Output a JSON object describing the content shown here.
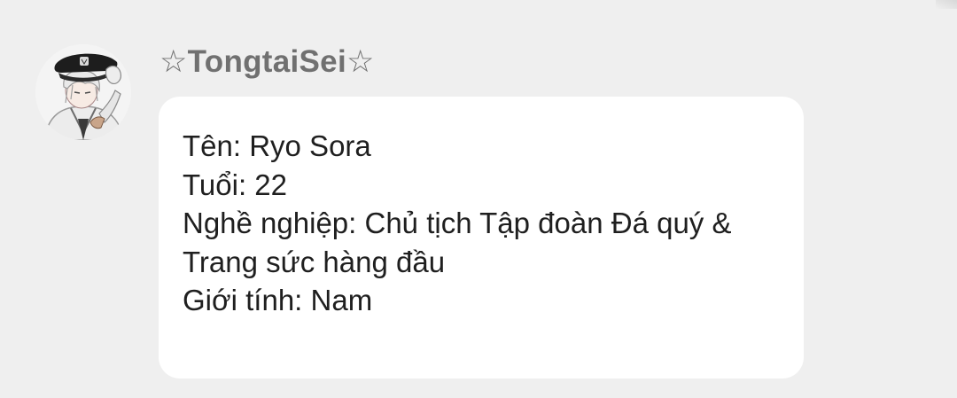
{
  "message": {
    "sender": {
      "name": "☆TongtaiSei☆",
      "avatar_icon": "user-avatar-icon"
    },
    "lines": [
      "Tên: Ryo Sora",
      "Tuổi: 22",
      "Nghề nghiệp: Chủ tịch Tập đoàn Đá quý &",
      "Trang sức hàng đầu",
      "Giới tính: Nam"
    ]
  },
  "colors": {
    "background": "#efefef",
    "bubble": "#ffffff",
    "sender_name": "#707070",
    "text": "#1f1f1f"
  }
}
